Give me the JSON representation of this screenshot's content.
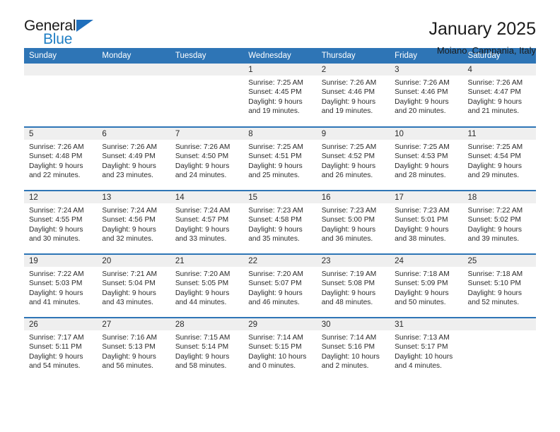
{
  "brand": {
    "name_top": "General",
    "name_bottom": "Blue",
    "flag_icon": "triangle-flag-icon",
    "accent_color": "#1f7ec4"
  },
  "header": {
    "title": "January 2025",
    "subtitle": "Moiano, Campania, Italy"
  },
  "theme": {
    "header_blue": "#2e75b6",
    "band_gray": "#efefef",
    "text": "#2b2b2b"
  },
  "weekday_headers": [
    "Sunday",
    "Monday",
    "Tuesday",
    "Wednesday",
    "Thursday",
    "Friday",
    "Saturday"
  ],
  "weeks": [
    [
      {
        "day": "",
        "lines": []
      },
      {
        "day": "",
        "lines": []
      },
      {
        "day": "",
        "lines": []
      },
      {
        "day": "1",
        "lines": [
          "Sunrise: 7:25 AM",
          "Sunset: 4:45 PM",
          "Daylight: 9 hours",
          "and 19 minutes."
        ]
      },
      {
        "day": "2",
        "lines": [
          "Sunrise: 7:26 AM",
          "Sunset: 4:46 PM",
          "Daylight: 9 hours",
          "and 19 minutes."
        ]
      },
      {
        "day": "3",
        "lines": [
          "Sunrise: 7:26 AM",
          "Sunset: 4:46 PM",
          "Daylight: 9 hours",
          "and 20 minutes."
        ]
      },
      {
        "day": "4",
        "lines": [
          "Sunrise: 7:26 AM",
          "Sunset: 4:47 PM",
          "Daylight: 9 hours",
          "and 21 minutes."
        ]
      }
    ],
    [
      {
        "day": "5",
        "lines": [
          "Sunrise: 7:26 AM",
          "Sunset: 4:48 PM",
          "Daylight: 9 hours",
          "and 22 minutes."
        ]
      },
      {
        "day": "6",
        "lines": [
          "Sunrise: 7:26 AM",
          "Sunset: 4:49 PM",
          "Daylight: 9 hours",
          "and 23 minutes."
        ]
      },
      {
        "day": "7",
        "lines": [
          "Sunrise: 7:26 AM",
          "Sunset: 4:50 PM",
          "Daylight: 9 hours",
          "and 24 minutes."
        ]
      },
      {
        "day": "8",
        "lines": [
          "Sunrise: 7:25 AM",
          "Sunset: 4:51 PM",
          "Daylight: 9 hours",
          "and 25 minutes."
        ]
      },
      {
        "day": "9",
        "lines": [
          "Sunrise: 7:25 AM",
          "Sunset: 4:52 PM",
          "Daylight: 9 hours",
          "and 26 minutes."
        ]
      },
      {
        "day": "10",
        "lines": [
          "Sunrise: 7:25 AM",
          "Sunset: 4:53 PM",
          "Daylight: 9 hours",
          "and 28 minutes."
        ]
      },
      {
        "day": "11",
        "lines": [
          "Sunrise: 7:25 AM",
          "Sunset: 4:54 PM",
          "Daylight: 9 hours",
          "and 29 minutes."
        ]
      }
    ],
    [
      {
        "day": "12",
        "lines": [
          "Sunrise: 7:24 AM",
          "Sunset: 4:55 PM",
          "Daylight: 9 hours",
          "and 30 minutes."
        ]
      },
      {
        "day": "13",
        "lines": [
          "Sunrise: 7:24 AM",
          "Sunset: 4:56 PM",
          "Daylight: 9 hours",
          "and 32 minutes."
        ]
      },
      {
        "day": "14",
        "lines": [
          "Sunrise: 7:24 AM",
          "Sunset: 4:57 PM",
          "Daylight: 9 hours",
          "and 33 minutes."
        ]
      },
      {
        "day": "15",
        "lines": [
          "Sunrise: 7:23 AM",
          "Sunset: 4:58 PM",
          "Daylight: 9 hours",
          "and 35 minutes."
        ]
      },
      {
        "day": "16",
        "lines": [
          "Sunrise: 7:23 AM",
          "Sunset: 5:00 PM",
          "Daylight: 9 hours",
          "and 36 minutes."
        ]
      },
      {
        "day": "17",
        "lines": [
          "Sunrise: 7:23 AM",
          "Sunset: 5:01 PM",
          "Daylight: 9 hours",
          "and 38 minutes."
        ]
      },
      {
        "day": "18",
        "lines": [
          "Sunrise: 7:22 AM",
          "Sunset: 5:02 PM",
          "Daylight: 9 hours",
          "and 39 minutes."
        ]
      }
    ],
    [
      {
        "day": "19",
        "lines": [
          "Sunrise: 7:22 AM",
          "Sunset: 5:03 PM",
          "Daylight: 9 hours",
          "and 41 minutes."
        ]
      },
      {
        "day": "20",
        "lines": [
          "Sunrise: 7:21 AM",
          "Sunset: 5:04 PM",
          "Daylight: 9 hours",
          "and 43 minutes."
        ]
      },
      {
        "day": "21",
        "lines": [
          "Sunrise: 7:20 AM",
          "Sunset: 5:05 PM",
          "Daylight: 9 hours",
          "and 44 minutes."
        ]
      },
      {
        "day": "22",
        "lines": [
          "Sunrise: 7:20 AM",
          "Sunset: 5:07 PM",
          "Daylight: 9 hours",
          "and 46 minutes."
        ]
      },
      {
        "day": "23",
        "lines": [
          "Sunrise: 7:19 AM",
          "Sunset: 5:08 PM",
          "Daylight: 9 hours",
          "and 48 minutes."
        ]
      },
      {
        "day": "24",
        "lines": [
          "Sunrise: 7:18 AM",
          "Sunset: 5:09 PM",
          "Daylight: 9 hours",
          "and 50 minutes."
        ]
      },
      {
        "day": "25",
        "lines": [
          "Sunrise: 7:18 AM",
          "Sunset: 5:10 PM",
          "Daylight: 9 hours",
          "and 52 minutes."
        ]
      }
    ],
    [
      {
        "day": "26",
        "lines": [
          "Sunrise: 7:17 AM",
          "Sunset: 5:11 PM",
          "Daylight: 9 hours",
          "and 54 minutes."
        ]
      },
      {
        "day": "27",
        "lines": [
          "Sunrise: 7:16 AM",
          "Sunset: 5:13 PM",
          "Daylight: 9 hours",
          "and 56 minutes."
        ]
      },
      {
        "day": "28",
        "lines": [
          "Sunrise: 7:15 AM",
          "Sunset: 5:14 PM",
          "Daylight: 9 hours",
          "and 58 minutes."
        ]
      },
      {
        "day": "29",
        "lines": [
          "Sunrise: 7:14 AM",
          "Sunset: 5:15 PM",
          "Daylight: 10 hours",
          "and 0 minutes."
        ]
      },
      {
        "day": "30",
        "lines": [
          "Sunrise: 7:14 AM",
          "Sunset: 5:16 PM",
          "Daylight: 10 hours",
          "and 2 minutes."
        ]
      },
      {
        "day": "31",
        "lines": [
          "Sunrise: 7:13 AM",
          "Sunset: 5:17 PM",
          "Daylight: 10 hours",
          "and 4 minutes."
        ]
      },
      {
        "day": "",
        "lines": []
      }
    ]
  ]
}
